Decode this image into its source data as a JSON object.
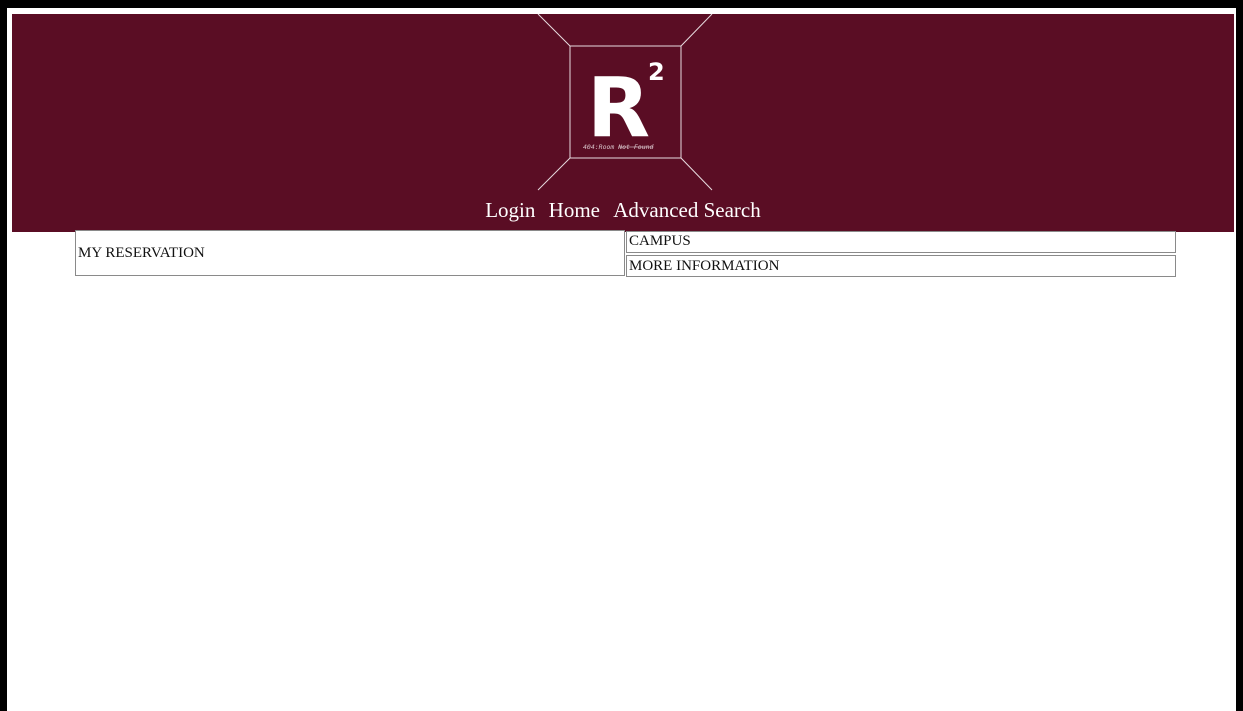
{
  "logo": {
    "letter": "R",
    "superscript": "2",
    "tagline_prefix": "404:Room",
    "tagline_suffix": "Not Found",
    "colors": {
      "header_bg": "#5a0d24",
      "logo_fg": "#ffffff"
    }
  },
  "nav": {
    "items": [
      {
        "label": "Login"
      },
      {
        "label": "Home"
      },
      {
        "label": "Advanced Search"
      }
    ]
  },
  "panels": {
    "my_reservation": "MY RESERVATION",
    "campus": "CAMPUS",
    "more_information": "MORE INFORMATION"
  }
}
